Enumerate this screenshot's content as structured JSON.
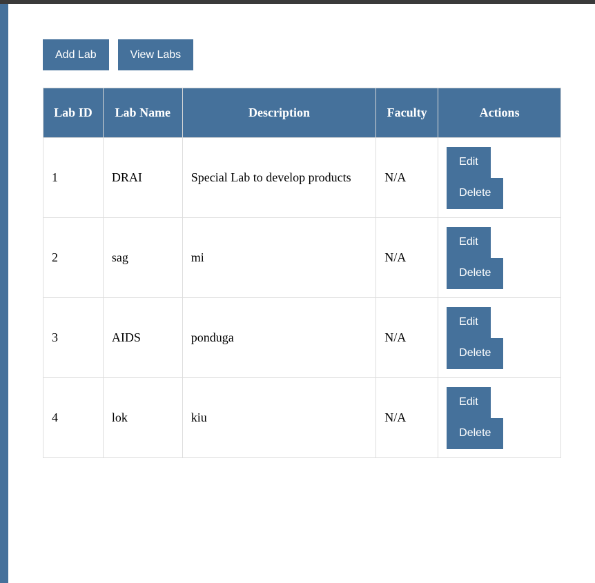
{
  "toolbar": {
    "add_lab_label": "Add Lab",
    "view_labs_label": "View Labs"
  },
  "table": {
    "headers": [
      "Lab ID",
      "Lab Name",
      "Description",
      "Faculty",
      "Actions"
    ],
    "rows": [
      {
        "id": "1",
        "name": "DRAI",
        "description": "Special Lab to develop products",
        "faculty": "N/A"
      },
      {
        "id": "2",
        "name": "sag",
        "description": "mi",
        "faculty": "N/A"
      },
      {
        "id": "3",
        "name": "AIDS",
        "description": "ponduga",
        "faculty": "N/A"
      },
      {
        "id": "4",
        "name": "lok",
        "description": "kiu",
        "faculty": "N/A"
      }
    ],
    "edit_label": "Edit",
    "delete_label": "Delete"
  },
  "colors": {
    "accent": "#45719b",
    "top_bar": "#3a3a3a"
  }
}
